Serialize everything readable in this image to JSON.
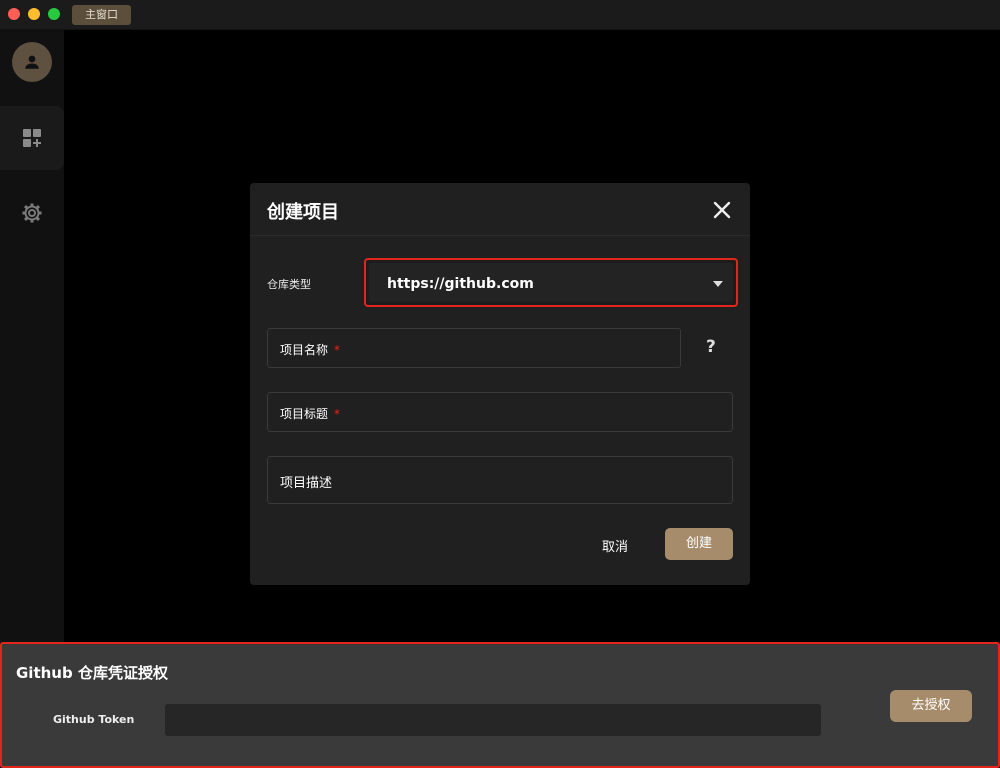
{
  "window": {
    "tab_label": "主窗口"
  },
  "sidebar": {
    "items": [
      {
        "icon": "user-icon"
      },
      {
        "icon": "add-project-icon",
        "active": true
      },
      {
        "icon": "gear-icon"
      }
    ]
  },
  "dialog": {
    "title": "创建项目",
    "repo_type_label": "仓库类型",
    "repo_type_value": "https://github.com",
    "project_name_label": "项目名称",
    "project_title_label": "项目标题",
    "project_desc_label": "项目描述",
    "required_mark": "*",
    "help_symbol": "?",
    "cancel_label": "取消",
    "create_label": "创建"
  },
  "auth_panel": {
    "title": "Github 仓库凭证授权",
    "token_label": "Github Token",
    "token_value": "",
    "authorize_label": "去授权"
  },
  "colors": {
    "accent": "#a78c6c",
    "highlight": "#e2261b",
    "dialog_bg": "#202020",
    "panel_bg": "#3a3a3a"
  }
}
